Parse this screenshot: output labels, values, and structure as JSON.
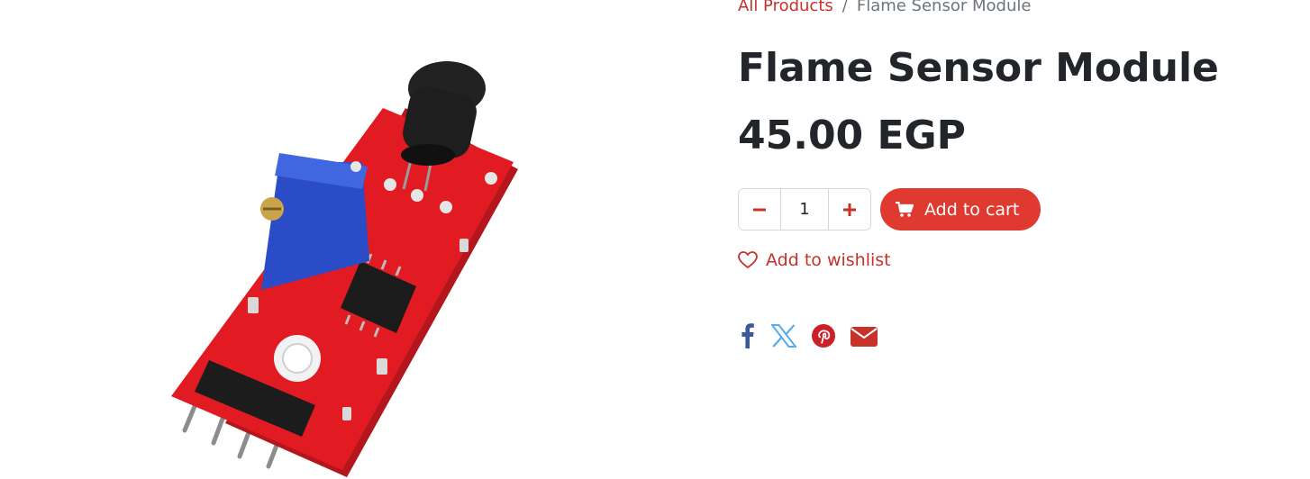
{
  "breadcrumb": {
    "all_products": "All Products",
    "separator": "/",
    "current": "Flame Sensor Module"
  },
  "product": {
    "name": "Flame Sensor Module",
    "price": "45.00 EGP",
    "image_alt": "Flame Sensor Module"
  },
  "quantity": {
    "value": "1",
    "minus_icon": "minus-icon",
    "plus_icon": "plus-icon"
  },
  "cart": {
    "label": "Add to cart",
    "icon": "shopping-cart-icon"
  },
  "wishlist": {
    "label": "Add to wishlist",
    "icon": "heart-icon"
  },
  "share": {
    "icons": [
      "facebook-icon",
      "x-twitter-icon",
      "pinterest-icon",
      "email-icon"
    ]
  },
  "colors": {
    "accent": "#e03a30",
    "link": "#c8302a",
    "text": "#222529",
    "facebook": "#3b5998",
    "twitter": "#55acee",
    "pinterest": "#cb2027",
    "email": "#c8302a"
  }
}
